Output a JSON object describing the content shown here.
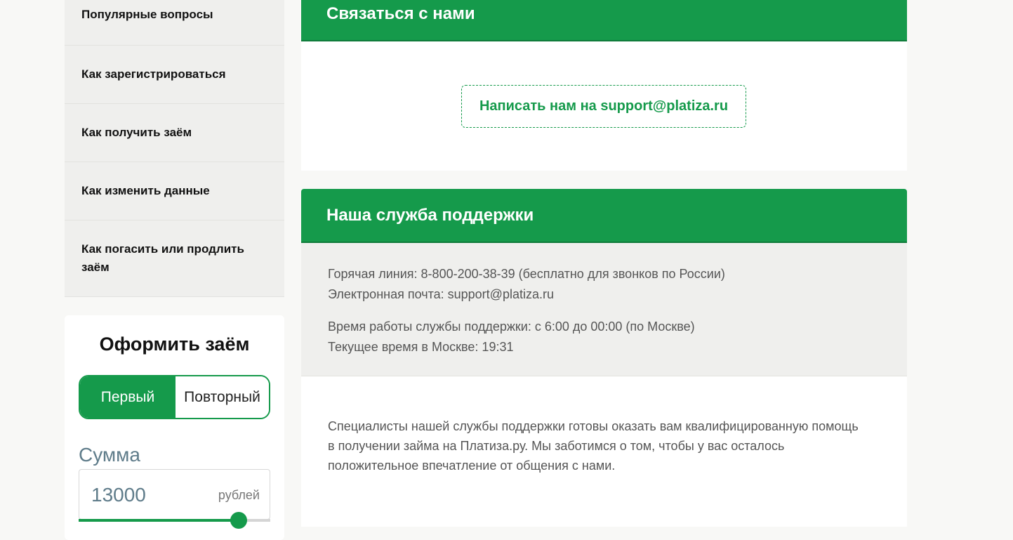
{
  "sidebar": {
    "items": [
      {
        "label": "Популярные вопросы"
      },
      {
        "label": "Как зарегистрироваться"
      },
      {
        "label": "Как получить заём"
      },
      {
        "label": "Как изменить данные"
      },
      {
        "label": "Как погасить или продлить заём"
      }
    ]
  },
  "loan_form": {
    "title": "Оформить заём",
    "tabs": [
      {
        "label": "Первый",
        "active": true
      },
      {
        "label": "Повторный",
        "active": false
      }
    ],
    "amount_label": "Сумма",
    "amount_value": "13000",
    "amount_unit": "рублей",
    "slider_fraction": 0.835
  },
  "contact_panel": {
    "title": "Связаться с нами",
    "mail_button": "Написать нам на support@platiza.ru"
  },
  "support_panel": {
    "title": "Наша служба поддержки",
    "hotline": "Горячая линия: 8-800-200-38-39 (бесплатно для звонков по России)",
    "email": "Электронная почта: support@platiza.ru",
    "hours": "Время работы службы поддержки: с 6:00 до 00:00 (по Москве)",
    "current_time": "Текущее время в Москве: 19:31",
    "description": "Специалисты нашей службы поддержки готовы оказать вам квалифицированную помощь в получении займа на Платиза.ру. Мы заботимся о том, чтобы у вас осталось положительное впечатление от общения с нами."
  },
  "colors": {
    "brand_green": "#159a4b",
    "panel_gray": "#efefed",
    "page_bg": "#f8f8f6"
  }
}
